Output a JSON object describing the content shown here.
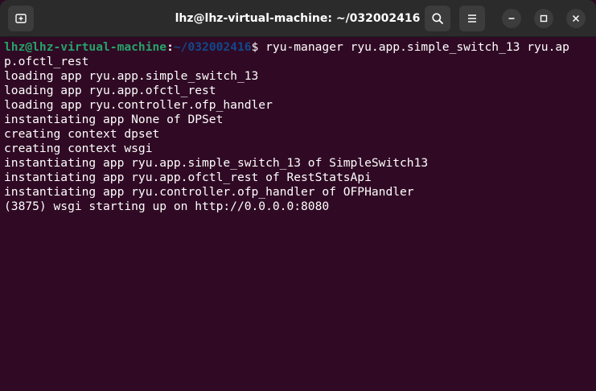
{
  "window": {
    "title": "lhz@lhz-virtual-machine: ~/032002416"
  },
  "titlebar": {
    "icons": {
      "new_tab": "new-tab-icon",
      "search": "search-icon",
      "menu": "hamburger-menu-icon",
      "minimize": "minimize-icon",
      "maximize": "maximize-icon",
      "close": "close-icon"
    }
  },
  "prompt": {
    "user_host": "lhz@lhz-virtual-machine",
    "colon": ":",
    "path": "~/032002416",
    "dollar": "$",
    "command_line1": " ryu-manager ryu.app.simple_switch_13 ryu.ap",
    "command_line2": "p.ofctl_rest"
  },
  "output": [
    "loading app ryu.app.simple_switch_13",
    "loading app ryu.app.ofctl_rest",
    "loading app ryu.controller.ofp_handler",
    "instantiating app None of DPSet",
    "creating context dpset",
    "creating context wsgi",
    "instantiating app ryu.app.simple_switch_13 of SimpleSwitch13",
    "instantiating app ryu.app.ofctl_rest of RestStatsApi",
    "instantiating app ryu.controller.ofp_handler of OFPHandler",
    "(3875) wsgi starting up on http://0.0.0.0:8080"
  ],
  "colors": {
    "terminal_bg": "#300a24",
    "titlebar_bg": "#2b2b2b",
    "prompt_user": "#26a269",
    "prompt_path": "#12488b",
    "text": "#ffffff"
  }
}
